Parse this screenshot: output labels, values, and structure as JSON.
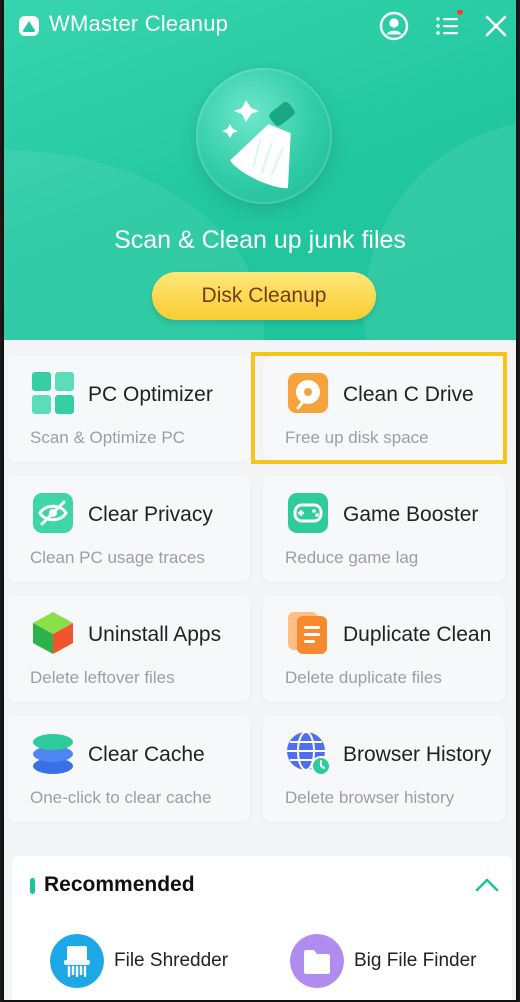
{
  "app": {
    "title": "WMaster Cleanup"
  },
  "titlebar": {
    "account_icon": "account-icon",
    "menu_icon": "menu-list-icon",
    "close_icon": "close-icon",
    "menu_badge_color": "#ff3b30"
  },
  "hero": {
    "headline": "Scan & Clean up junk files",
    "button_label": "Disk Cleanup",
    "illustration": "broom-icon",
    "background_color": "#22c79f",
    "button_color": "#f8cd2f"
  },
  "tools": [
    {
      "name": "PC Optimizer",
      "desc": "Scan & Optimize PC",
      "icon": "pc-optimizer-icon"
    },
    {
      "name": "Clean C Drive",
      "desc": "Free up disk space",
      "icon": "clean-c-drive-icon",
      "highlighted": true
    },
    {
      "name": "Clear Privacy",
      "desc": "Clean PC usage traces",
      "icon": "clear-privacy-icon"
    },
    {
      "name": "Game Booster",
      "desc": "Reduce game lag",
      "icon": "game-booster-icon"
    },
    {
      "name": "Uninstall Apps",
      "desc": "Delete leftover files",
      "icon": "uninstall-apps-icon"
    },
    {
      "name": "Duplicate Clean",
      "desc": "Delete duplicate files",
      "icon": "duplicate-clean-icon"
    },
    {
      "name": "Clear Cache",
      "desc": "One-click to clear cache",
      "icon": "clear-cache-icon"
    },
    {
      "name": "Browser History",
      "desc": "Delete browser history",
      "icon": "browser-history-icon"
    }
  ],
  "highlight_color": "#f5c518",
  "recommended": {
    "title": "Recommended",
    "collapse_icon": "chevron-up-icon",
    "items": [
      {
        "name": "File Shredder",
        "icon": "file-shredder-icon",
        "color": "#1ea7e6"
      },
      {
        "name": "Big File Finder",
        "icon": "big-file-finder-icon",
        "color": "#b08cf0"
      }
    ]
  }
}
